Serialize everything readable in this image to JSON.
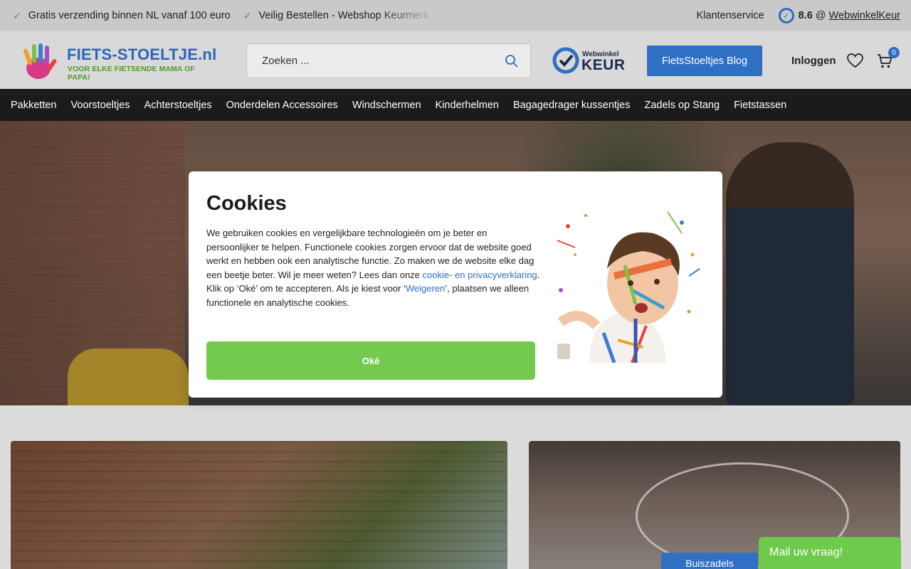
{
  "topbar": {
    "usps": [
      "Gratis verzending binnen NL vanaf 100 euro",
      "Veilig Bestellen - Webshop Keurmerk"
    ],
    "service": "Klantenservice",
    "rating_score": "8.6",
    "rating_at": "@",
    "rating_source": "WebwinkelKeur"
  },
  "header": {
    "logo_title": "FIETS-STOELTJE.nl",
    "logo_subtitle": "VOOR ELKE FIETSENDE MAMA OF PAPA!",
    "search_placeholder": "Zoeken ...",
    "keur_small": "Webwinkel",
    "keur_big": "KEUR",
    "blog_button": "FietsStoeltjes Blog",
    "login": "Inloggen",
    "cart_count": "0"
  },
  "nav": {
    "items": [
      "Pakketten",
      "Voorstoeltjes",
      "Achterstoeltjes",
      "Onderdelen Accessoires",
      "Windschermen",
      "Kinderhelmen",
      "Bagagedrager kussentjes",
      "Zadels op Stang",
      "Fietstassen"
    ]
  },
  "cookie": {
    "title": "Cookies",
    "text_1": "We gebruiken cookies en vergelijkbare technologieën om je beter en persoonlijker te helpen. Functionele cookies zorgen ervoor dat de website goed werkt en hebben ook een analytische functie. Zo maken we de website elke dag een beetje beter. Wil je meer weten? Lees dan onze ",
    "link_privacy": "cookie- en privacyverklaring",
    "text_2": ".",
    "text_3": "Klik op ‘Oké’ om te accepteren. Als je kiest voor ‘",
    "link_weigeren": "Weigeren",
    "text_4": "’, plaatsen we alleen functionele en analytische cookies.",
    "ok_button": "Oké"
  },
  "tiles": {
    "right_label": "Buiszadels"
  },
  "chat": {
    "label": "Mail uw vraag!"
  },
  "colors": {
    "brand_blue": "#2f6fc4",
    "brand_green": "#74c94f",
    "nav_bg": "#1b1b1b"
  }
}
